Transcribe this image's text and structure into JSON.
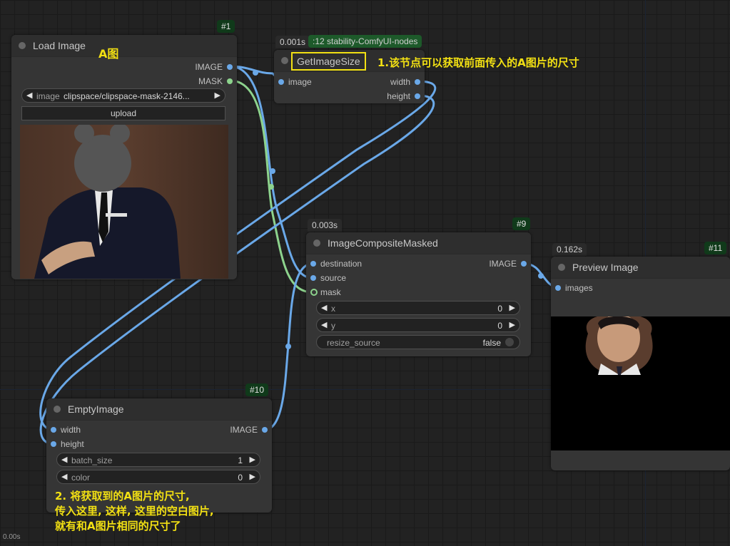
{
  "colors": {
    "canvas": "#222222",
    "node_bg": "#353535",
    "wire_image": "#6aa8e8",
    "wire_mask": "#8dd38d",
    "annotation": "#f2e013",
    "node_id_badge": "#103a1a"
  },
  "nodes": {
    "load_image": {
      "id": "#1",
      "title": "Load Image",
      "outputs": [
        "IMAGE",
        "MASK"
      ],
      "image_widget": {
        "name": "image",
        "value": "clipspace/clipspace-mask-2146..."
      },
      "upload_label": "upload"
    },
    "get_image_size": {
      "time": "0.001s",
      "source_tag": ":12 stability-ComfyUI-nodes",
      "title": "GetImageSize",
      "inputs": [
        "image"
      ],
      "outputs": [
        "width",
        "height"
      ]
    },
    "image_composite_masked": {
      "id": "#9",
      "time": "0.003s",
      "title": "ImageCompositeMasked",
      "inputs": [
        "destination",
        "source",
        "mask"
      ],
      "outputs": [
        "IMAGE"
      ],
      "widgets": [
        {
          "name": "x",
          "value": "0"
        },
        {
          "name": "y",
          "value": "0"
        }
      ],
      "toggle": {
        "name": "resize_source",
        "value": "false"
      }
    },
    "preview_image": {
      "id": "#11",
      "time": "0.162s",
      "title": "Preview Image",
      "inputs": [
        "images"
      ]
    },
    "empty_image": {
      "id": "#10",
      "title": "EmptyImage",
      "inputs": [
        "width",
        "height"
      ],
      "outputs": [
        "IMAGE"
      ],
      "widgets": [
        {
          "name": "batch_size",
          "value": "1"
        },
        {
          "name": "color",
          "value": "0"
        }
      ]
    }
  },
  "annotations": {
    "a_label": "A图",
    "note1": "1.该节点可以获取前面传入的A图片的尺寸",
    "note2_line1": "2. 将获取到的A图片的尺寸,",
    "note2_line2": "传入这里, 这样, 这里的空白图片,",
    "note2_line3": "就有和A图片相同的尺寸了"
  },
  "footer": {
    "time": "0.00s"
  },
  "icons": {
    "node_collapse": "circle-dot-icon",
    "decrement": "triangle-left-icon",
    "increment": "triangle-right-icon"
  }
}
